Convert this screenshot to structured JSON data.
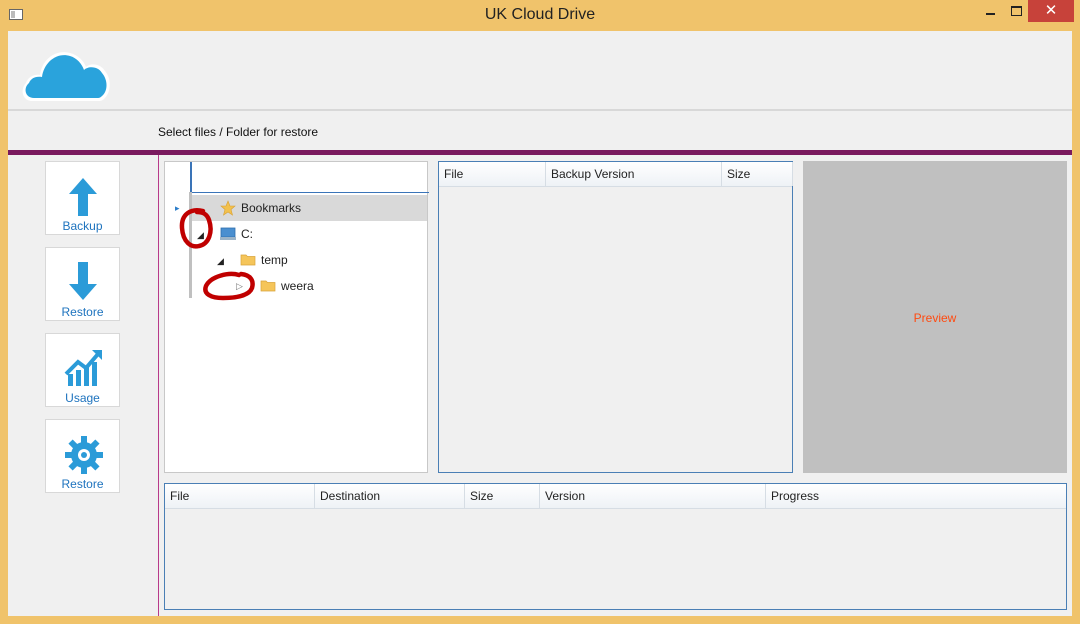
{
  "window": {
    "title": "UK Cloud Drive",
    "close_glyph": "✕"
  },
  "subbar": {
    "label": "Select files / Folder for restore"
  },
  "sidebar": {
    "items": [
      {
        "label": "Backup",
        "icon": "arrow-up-icon"
      },
      {
        "label": "Restore",
        "icon": "arrow-down-icon"
      },
      {
        "label": "Usage",
        "icon": "chart-up-icon"
      },
      {
        "label": "Restore",
        "icon": "gear-icon"
      }
    ]
  },
  "tree": {
    "nodes": [
      {
        "label": "Bookmarks",
        "icon": "star-icon",
        "expander": "▸"
      },
      {
        "label": "C:",
        "icon": "drive-icon",
        "expander": "◢"
      },
      {
        "label": "temp",
        "icon": "folder-icon",
        "expander": "◢"
      },
      {
        "label": "weera",
        "icon": "folder-icon",
        "expander": "▷"
      }
    ]
  },
  "files_grid": {
    "columns": [
      "File",
      "Backup Version",
      "Size"
    ]
  },
  "preview": {
    "label": "Preview"
  },
  "queue_grid": {
    "columns": [
      "File",
      "Destination",
      "Size",
      "Version",
      "Progress"
    ]
  },
  "colors": {
    "accent": "#7a1a5e",
    "frame": "#f0c36b",
    "link": "#1e73be",
    "preview_text": "#ff4a10",
    "annotation": "#c00000"
  }
}
